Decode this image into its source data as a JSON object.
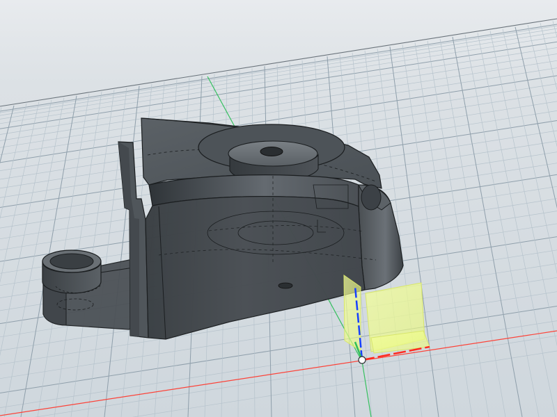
{
  "viewport": {
    "background_top": "#dfe3e6",
    "background_bottom": "#cfd6dc",
    "grid_minor": "#b6c3cc",
    "grid_major": "#8f9fab",
    "horizon": "#6e7780"
  },
  "axes": {
    "x_color": "#ff3b30",
    "y_color": "#2fbf5a",
    "z_color": "#1640ff"
  },
  "model": {
    "shell_dark": "#3e4347",
    "shell_mid": "#4b5055",
    "shell_light": "#6a7075",
    "edge": "#1b1e20"
  },
  "manipulator": {
    "plane_fill": "#f1ff8c",
    "plane_edge": "#d8e66a",
    "origin_fill": "#ffffff"
  }
}
